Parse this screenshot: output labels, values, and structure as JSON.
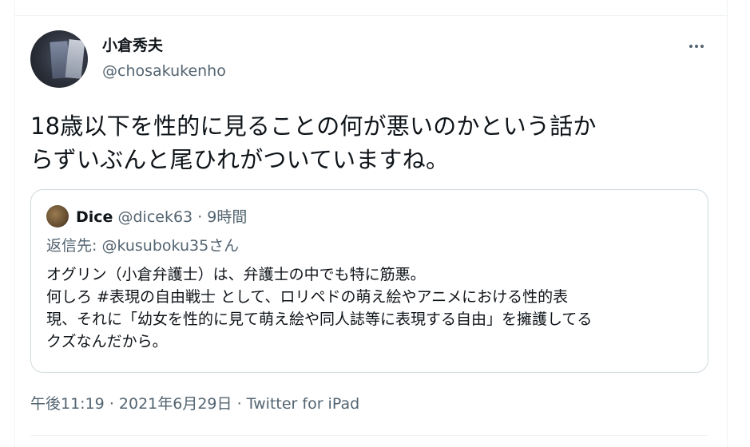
{
  "tweet": {
    "author_name": "小倉秀夫",
    "author_handle": "@chosakukenho",
    "text": "18歳以下を性的に見ることの何が悪いのかという話か\nらずいぶんと尾ひれがついていますね。",
    "timestamp": "午後11:19",
    "date": "2021年6月29日",
    "source": "Twitter for iPad",
    "separator": "·",
    "more_icon": "more-horizontal-icon"
  },
  "quoted_tweet": {
    "author_name": "Dice",
    "author_handle": "@dicek63",
    "separator": "·",
    "time_ago": "9時間",
    "reply_to": "返信先: @kusuboku35さん",
    "text": "オグリン（小倉弁護士）は、弁護士の中でも特に筋悪。\n何しろ #表現の自由戦士 として、ロリペドの萌え絵やアニメにおける性的表\n現、それに「幼女を性的に見て萌え絵や同人誌等に表現する自由」を擁護してる\nクズなんだから。"
  },
  "colors": {
    "text_primary": "#0f1419",
    "text_secondary": "#536471",
    "border": "#cfd9de",
    "divider": "#eff3f4"
  }
}
